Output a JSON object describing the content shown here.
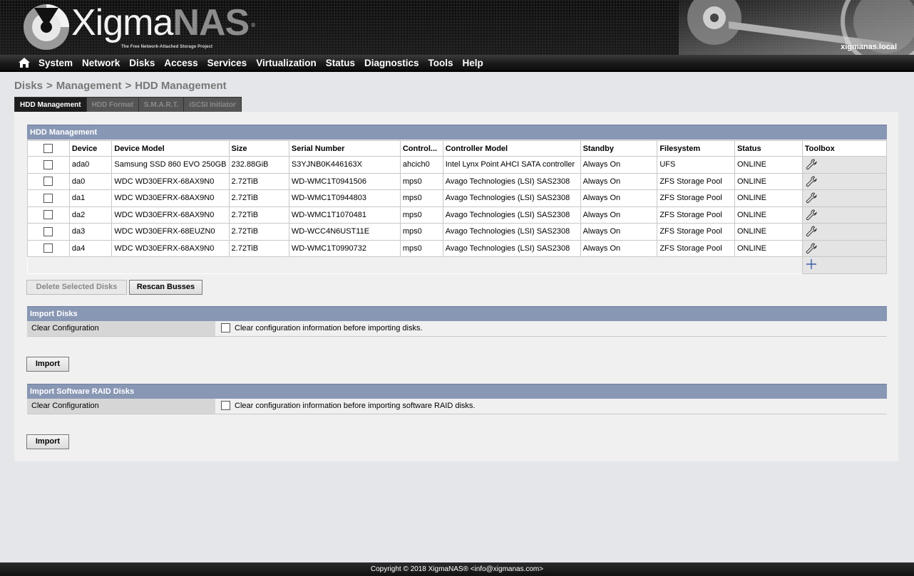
{
  "brand": {
    "name_part1": "Xigma",
    "name_part2": "NAS",
    "registered": "®",
    "tagline": "The Free Network-Attached Storage Project",
    "hostname": "xigmanas.local"
  },
  "nav": {
    "home_icon": "home-icon",
    "items": [
      "System",
      "Network",
      "Disks",
      "Access",
      "Services",
      "Virtualization",
      "Status",
      "Diagnostics",
      "Tools",
      "Help"
    ]
  },
  "breadcrumb": [
    "Disks",
    "Management",
    "HDD Management"
  ],
  "breadcrumb_sep": ">",
  "tabs": [
    {
      "label": "HDD Management",
      "active": true
    },
    {
      "label": "HDD Format",
      "active": false
    },
    {
      "label": "S.M.A.R.T.",
      "active": false
    },
    {
      "label": "iSCSI Initiator",
      "active": false
    }
  ],
  "hdd_section": {
    "title": "HDD Management",
    "columns": [
      "",
      "Device",
      "Device Model",
      "Size",
      "Serial Number",
      "Control...",
      "Controller Model",
      "Standby",
      "Filesystem",
      "Status",
      "Toolbox"
    ],
    "rows": [
      [
        "ada0",
        "Samsung SSD 860 EVO 250GB",
        "232.88GiB",
        "S3YJNB0K446163X",
        "ahcich0",
        "Intel Lynx Point AHCI SATA controller",
        "Always On",
        "UFS",
        "ONLINE"
      ],
      [
        "da0",
        "WDC WD30EFRX-68AX9N0",
        "2.72TiB",
        "WD-WMC1T0941506",
        "mps0",
        "Avago Technologies (LSI) SAS2308",
        "Always On",
        "ZFS Storage Pool",
        "ONLINE"
      ],
      [
        "da1",
        "WDC WD30EFRX-68AX9N0",
        "2.72TiB",
        "WD-WMC1T0944803",
        "mps0",
        "Avago Technologies (LSI) SAS2308",
        "Always On",
        "ZFS Storage Pool",
        "ONLINE"
      ],
      [
        "da2",
        "WDC WD30EFRX-68AX9N0",
        "2.72TiB",
        "WD-WMC1T1070481",
        "mps0",
        "Avago Technologies (LSI) SAS2308",
        "Always On",
        "ZFS Storage Pool",
        "ONLINE"
      ],
      [
        "da3",
        "WDC WD30EFRX-68EUZN0",
        "2.72TiB",
        "WD-WCC4N6UST11E",
        "mps0",
        "Avago Technologies (LSI) SAS2308",
        "Always On",
        "ZFS Storage Pool",
        "ONLINE"
      ],
      [
        "da4",
        "WDC WD30EFRX-68AX9N0",
        "2.72TiB",
        "WD-WMC1T0990732",
        "mps0",
        "Avago Technologies (LSI) SAS2308",
        "Always On",
        "ZFS Storage Pool",
        "ONLINE"
      ]
    ],
    "row_tool_icon": "wrench-icon",
    "add_icon": "plus-icon",
    "delete_button": "Delete Selected Disks",
    "rescan_button": "Rescan Busses"
  },
  "import_disks": {
    "title": "Import Disks",
    "option_label": "Clear Configuration",
    "option_text": "Clear configuration information before importing disks.",
    "button": "Import"
  },
  "import_raid": {
    "title": "Import Software RAID Disks",
    "option_label": "Clear Configuration",
    "option_text": "Clear configuration information before importing software RAID disks.",
    "button": "Import"
  },
  "footer": {
    "text": "Copyright © 2018 XigmaNAS® <info@xigmanas.com>"
  },
  "colors": {
    "section_header": "#8897b4",
    "nav_bg": "#1a1a1a",
    "page_bg": "#e4e6e9"
  }
}
